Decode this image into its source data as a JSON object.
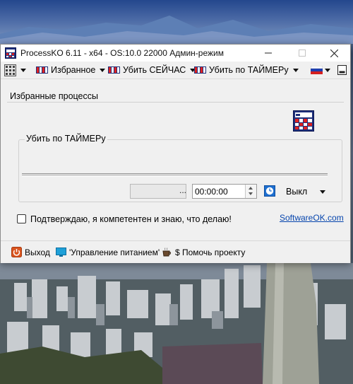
{
  "window": {
    "title": "ProcessKO 6.11 - x64  - OS:10.0 22000 Админ-режим"
  },
  "menubar": {
    "favorites_label": "Избранное",
    "kill_now_label": "Убить СЕЙЧАС",
    "kill_timer_label": "Убить по ТАЙМЕРу"
  },
  "main": {
    "favorites_group_title": "Избранные процессы",
    "timer_group_title": "Убить по ТАЙМЕРу",
    "path_dots": "...",
    "time_value": "00:00:00",
    "action_value": "Выкл",
    "confirm_label": "Подтверждаю, я компетентен и знаю, что делаю!",
    "website_link": "SoftwareOK.com",
    "confirm_checked": false
  },
  "bottombar": {
    "exit_label": "Выход",
    "power_label": "'Управление питанием'",
    "donate_label": "$ Помочь проекту"
  },
  "icons": {
    "app": "process-grid-icon",
    "menu_grid": "grid-menu-icon",
    "favorites": "process-bars-icon",
    "kill_now": "process-bars-icon",
    "kill_timer": "process-bars-icon",
    "flag": "russian-flag-icon",
    "minimize_tray": "tray-minimize-icon",
    "exit": "power-exit-icon",
    "power": "monitor-icon",
    "donate": "coffee-cup-icon",
    "timer": "clock-icon"
  },
  "colors": {
    "link": "#0645ad",
    "window_bg": "#f0f0f0",
    "exit_icon": "#d9541e"
  }
}
